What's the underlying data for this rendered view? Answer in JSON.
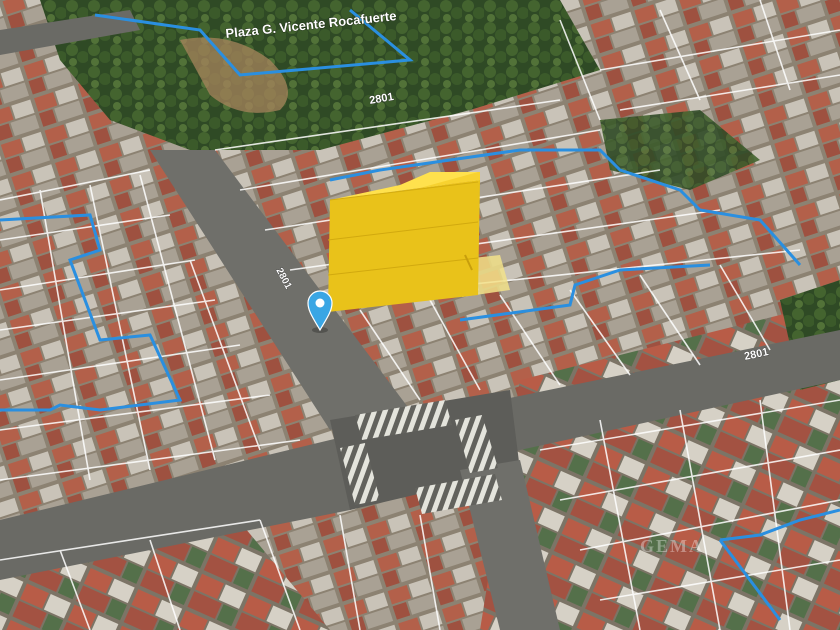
{
  "map": {
    "park_label": "Plaza G. Vicente Rocafuerte",
    "street_label_top": "2801",
    "street_label_right": "2801",
    "avenue_label": "2801",
    "watermark": "GEMA",
    "colors": {
      "boundary": "#2a8fe0",
      "parcel_lines": "#ffffff",
      "building_extrusion": "#f5cf1f",
      "building_top": "#ffe14d",
      "pin": "#3aa6e4",
      "street": "#6b6b67",
      "roof_red": "#b55a46",
      "tree": "#3d5a2c"
    },
    "icons": {
      "pin": "map-pin-icon"
    }
  }
}
